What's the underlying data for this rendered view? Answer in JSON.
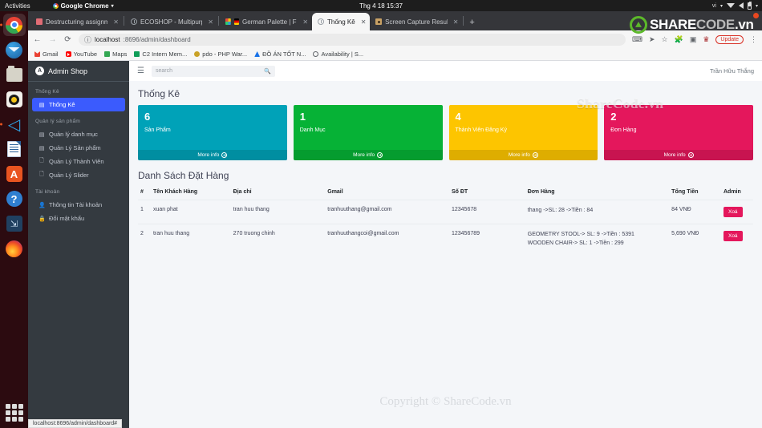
{
  "os": {
    "activities": "Activities",
    "app_menu": "Google Chrome",
    "clock": "Thg 4 18  15:37",
    "keyboard": "vi",
    "dock": [
      {
        "name": "google-chrome",
        "running": true,
        "active": true
      },
      {
        "name": "thunderbird",
        "running": false,
        "active": false
      },
      {
        "name": "files",
        "running": false,
        "active": false
      },
      {
        "name": "rhythmbox",
        "running": false,
        "active": false
      },
      {
        "name": "visual-studio-code",
        "running": true,
        "active": false
      },
      {
        "name": "libreoffice-writer",
        "running": false,
        "active": false
      },
      {
        "name": "ubuntu-software",
        "running": false,
        "active": false
      },
      {
        "name": "help",
        "running": false,
        "active": false
      },
      {
        "name": "tool",
        "running": false,
        "active": false
      },
      {
        "name": "firefox",
        "running": false,
        "active": false
      }
    ],
    "status_bar_link": "localhost:8696/admin/dashboard#"
  },
  "browser": {
    "tabs": [
      {
        "title": "Destructuring assignmen",
        "favicon": "js-icon",
        "active": false
      },
      {
        "title": "ECOSHOP - Multipurpose",
        "favicon": "globe-icon",
        "active": false
      },
      {
        "title": "German Palette | Flat U",
        "favicon": "palette-icon",
        "active": false
      },
      {
        "title": "Thống Kê",
        "favicon": "globe-icon",
        "active": true
      },
      {
        "title": "Screen Capture Result",
        "favicon": "camera-icon",
        "active": false
      }
    ],
    "new_tab_label": "+",
    "nav": {
      "back": "←",
      "forward": "→",
      "reload": "C"
    },
    "url": {
      "info_icon": "info-icon",
      "host": "localhost",
      "path": ":8696/admin/dashboard"
    },
    "update_label": "Update",
    "bookmarks": [
      {
        "label": "Gmail",
        "icon": "gmail-icon"
      },
      {
        "label": "YouTube",
        "icon": "youtube-icon"
      },
      {
        "label": "Maps",
        "icon": "maps-icon"
      },
      {
        "label": "C2 Intern Mem...",
        "icon": "green-doc-icon"
      },
      {
        "label": "pdo - PHP War...",
        "icon": "php-icon"
      },
      {
        "label": "ĐỒ ÁN TỐT N...",
        "icon": "drive-icon"
      },
      {
        "label": "Availability | S...",
        "icon": "globe-icon"
      }
    ]
  },
  "overlay": {
    "logo_part1": "SHARE",
    "logo_part2": "CODE",
    "logo_part3": ".vn",
    "watermark_cards": "ShareCode.vn",
    "watermark_footer": "Copyright © ShareCode.vn"
  },
  "sidebar": {
    "brand": "Admin Shop",
    "brand_icon": "admin-logo-icon",
    "groups": [
      {
        "heading": "Thống Kê",
        "items": [
          {
            "label": "Thống Kê",
            "icon": "chart-icon",
            "active": true,
            "key": "thong-ke"
          }
        ]
      },
      {
        "heading": "Quản lý sản phẩm",
        "items": [
          {
            "label": "Quản lý danh mục",
            "icon": "chart-icon",
            "active": false,
            "key": "danh-muc"
          },
          {
            "label": "Quản Lý Sản phẩm",
            "icon": "chart-icon",
            "active": false,
            "key": "san-pham"
          },
          {
            "label": "Quản Lý Thành Viên",
            "icon": "file-icon",
            "active": false,
            "key": "thanh-vien"
          },
          {
            "label": "Quản Lý Slider",
            "icon": "file-icon",
            "active": false,
            "key": "slider"
          }
        ]
      },
      {
        "heading": "Tài khoản",
        "items": [
          {
            "label": "Thông tin Tài khoản",
            "icon": "user-icon",
            "active": false,
            "key": "thong-tin"
          },
          {
            "label": "Đổi mật khẩu",
            "icon": "lock-icon",
            "active": false,
            "key": "doi-mat-khau"
          }
        ]
      }
    ]
  },
  "topbar": {
    "menu_icon": "hamburger-icon",
    "search_placeholder": "search",
    "search_icon": "search-icon",
    "user": "Trần Hữu Thắng"
  },
  "main": {
    "page_title": "Thống Kê",
    "cards": [
      {
        "value": "6",
        "label": "Sản Phẩm",
        "more": "More info",
        "color": "#00a2b8"
      },
      {
        "value": "1",
        "label": "Danh Mục",
        "more": "More info",
        "color": "#06b236"
      },
      {
        "value": "4",
        "label": "Thành Viên Đăng Ký",
        "more": "More info",
        "color": "#fdc500"
      },
      {
        "value": "2",
        "label": "Đơn Hàng",
        "more": "More info",
        "color": "#e4175c"
      }
    ],
    "table_title": "Danh Sách Đặt Hàng",
    "columns": [
      "#",
      "Tên Khách Hàng",
      "Địa chỉ",
      "Gmail",
      "Số ĐT",
      "Đơn Hàng",
      "Tổng Tiền",
      "Admin"
    ],
    "rows": [
      {
        "idx": "1",
        "name": "xuan phat",
        "address": "tran huu thang",
        "gmail": "tranhuuthang@gmail.com",
        "phone": "12345678",
        "order_lines": [
          "thang ->SL: 28 ->Tiền : 84"
        ],
        "total": "84 VNĐ",
        "action": "Xoá"
      },
      {
        "idx": "2",
        "name": "tran huu thang",
        "address": "270 truong chinh",
        "gmail": "tranhuuthangcoi@gmail.com",
        "phone": "123456789",
        "order_lines": [
          "GEOMETRY STOOL-> SL: 9 ->Tiền : 5391",
          "WOODEN CHAIR-> SL: 1 ->Tiền : 299"
        ],
        "total": "5,690 VNĐ",
        "action": "Xoá"
      }
    ]
  }
}
